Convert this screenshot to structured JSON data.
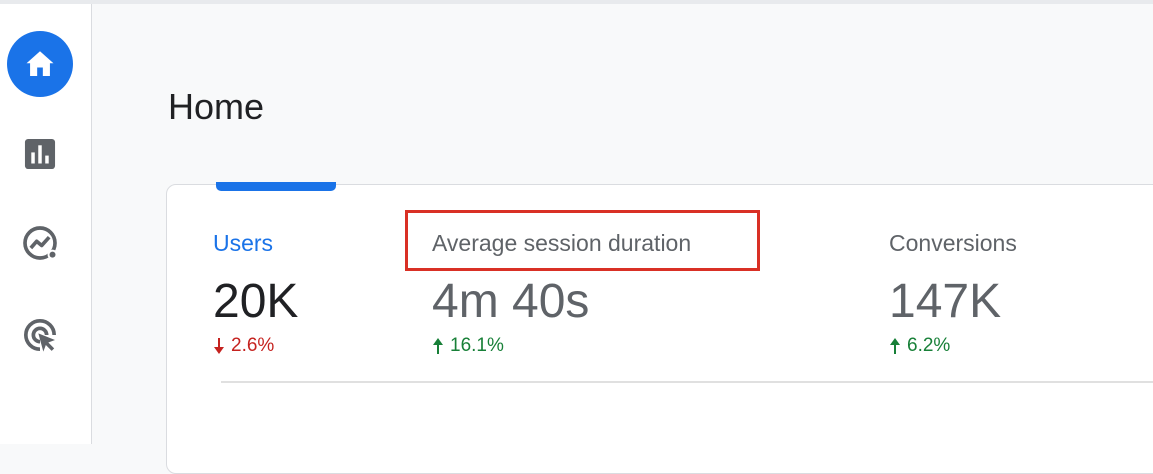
{
  "colors": {
    "accent": "#1a73e8",
    "highlight": "#d93025",
    "negative": "#c5221f",
    "positive": "#188038"
  },
  "sidebar": {
    "items": [
      {
        "icon": "home-icon",
        "active": true
      },
      {
        "icon": "reports-icon",
        "active": false
      },
      {
        "icon": "explore-icon",
        "active": false
      },
      {
        "icon": "advertising-icon",
        "active": false
      }
    ]
  },
  "page": {
    "title": "Home"
  },
  "metrics": [
    {
      "label": "Users",
      "value": "20K",
      "change": "2.6%",
      "direction": "down",
      "selected": true
    },
    {
      "label": "Average session duration",
      "value": "4m 40s",
      "change": "16.1%",
      "direction": "up",
      "selected": false
    },
    {
      "label": "Conversions",
      "value": "147K",
      "change": "6.2%",
      "direction": "up",
      "selected": false
    }
  ]
}
